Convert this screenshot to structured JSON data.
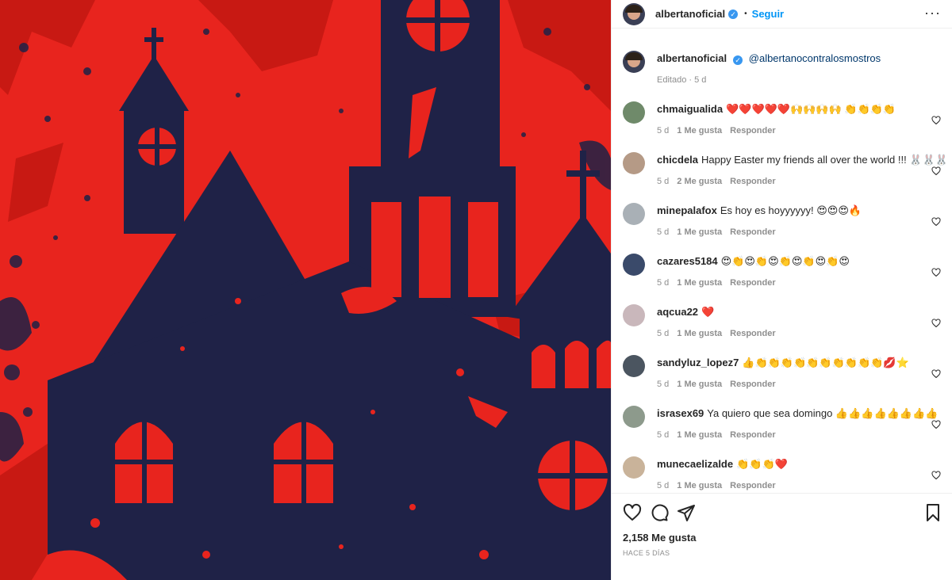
{
  "colors": {
    "link": "#0095f6",
    "verified": "#3897f0",
    "muted": "#8e8e8e",
    "image_red": "#e8241e",
    "image_navy": "#1f2247"
  },
  "header": {
    "username": "albertanoficial",
    "verified_icon": "verified-badge-icon",
    "separator": "•",
    "follow_label": "Seguir",
    "more_icon": "more-options-icon",
    "more_glyph": "···"
  },
  "caption": {
    "username": "albertanoficial",
    "mention": "@albertanocontralosmostros",
    "edited": "Editado · 5 d"
  },
  "comments": [
    {
      "username": "chmaigualida",
      "text": "❤️❤️❤️❤️❤️🙌🙌🙌🙌 👏👏👏👏",
      "time": "5 d",
      "likes": "1 Me gusta",
      "reply": "Responder",
      "avatar_color": "#6f8a6a"
    },
    {
      "username": "chicdela",
      "text": "Happy Easter my friends all over the world !!! 🐰🐰🐰",
      "time": "5 d",
      "likes": "2 Me gusta",
      "reply": "Responder",
      "avatar_color": "#b59a86"
    },
    {
      "username": "minepalafox",
      "text": "Es hoy es hoyyyyyy! 😍😍😍🔥",
      "time": "5 d",
      "likes": "1 Me gusta",
      "reply": "Responder",
      "avatar_color": "#a9b0b6"
    },
    {
      "username": "cazares5184",
      "text": "😍👏😍👏😍👏😍👏😍👏😍",
      "time": "5 d",
      "likes": "1 Me gusta",
      "reply": "Responder",
      "avatar_color": "#3a4a6a"
    },
    {
      "username": "aqcua22",
      "text": "❤️",
      "time": "5 d",
      "likes": "1 Me gusta",
      "reply": "Responder",
      "avatar_color": "#c9b7bb"
    },
    {
      "username": "sandyluz_lopez7",
      "text": "👍👏👏👏👏👏👏👏👏👏👏💋⭐",
      "time": "5 d",
      "likes": "1 Me gusta",
      "reply": "Responder",
      "avatar_color": "#4b5560"
    },
    {
      "username": "israsex69",
      "text": "Ya quiero que sea domingo 👍👍👍👍👍👍👍👍",
      "time": "5 d",
      "likes": "1 Me gusta",
      "reply": "Responder",
      "avatar_color": "#8d9a8c"
    },
    {
      "username": "munecaelizalde",
      "text": "👏👏👏❤️",
      "time": "5 d",
      "likes": "1 Me gusta",
      "reply": "Responder",
      "avatar_color": "#c9b39a"
    }
  ],
  "actions": {
    "like_icon": "heart-icon",
    "comment_icon": "comment-icon",
    "share_icon": "share-icon",
    "save_icon": "bookmark-icon",
    "likes_count": "2,158 Me gusta",
    "posted_ago": "HACE 5 DÍAS"
  }
}
